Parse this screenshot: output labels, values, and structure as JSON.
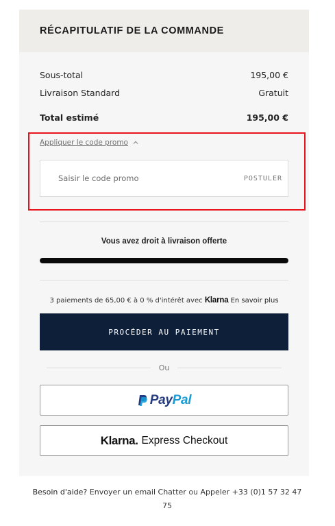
{
  "summary": {
    "title": "RÉCAPITULATIF DE LA COMMANDE",
    "subtotal_label": "Sous-total",
    "subtotal_value": "195,00 €",
    "shipping_label": "Livraison Standard",
    "shipping_value": "Gratuit",
    "total_label": "Total estimé",
    "total_value": "195,00 €"
  },
  "promo": {
    "toggle_label": "Appliquer le code promo",
    "input_placeholder": "Saisir le code promo",
    "input_value": "",
    "apply_label": "POSTULER"
  },
  "shipping_progress": {
    "message": "Vous avez droit à livraison offerte",
    "progress_percent": 100
  },
  "klarna_installments": {
    "text": "3 paiements de 65,00 € à 0 % d'intérêt avec",
    "brand": "Klarna",
    "link_label": "En savoir plus"
  },
  "checkout": {
    "pay_button_label": "PROCÉDER AU PAIEMENT",
    "or_label": "Ou",
    "paypal_pay": "Pay",
    "paypal_pal": "Pal",
    "klarna_brand": "Klarna.",
    "klarna_express": "Express Checkout"
  },
  "help": {
    "prefix": "Besoin d'aide?",
    "email_link": "Envoyer un email",
    "chat_link": "Chatter",
    "or_word": "ou",
    "call_prefix": "Appeler",
    "phone": "+33 (0)1 57 32 47 75"
  },
  "colors": {
    "pay_button_bg": "#0e1f3a",
    "highlight_border": "#e8131a",
    "paypal_dark": "#253b80",
    "paypal_light": "#179bd7"
  },
  "icons": {
    "promo_toggle": "chevron-up-icon",
    "paypal_logo": "paypal-logo-icon"
  }
}
